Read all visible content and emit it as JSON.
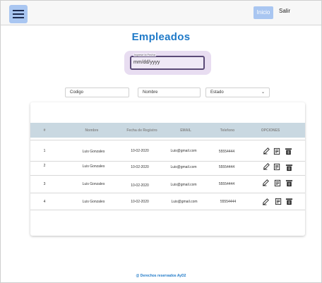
{
  "header": {
    "inicio": "Inicio",
    "salir": "Salir"
  },
  "main": {
    "title": "Empleados",
    "date": {
      "label": "Ingrese la Fecha",
      "placeholder": "mm/dd/yyyy"
    },
    "filters": {
      "codigo": "Codigo",
      "nombre": "Nombre",
      "estado": "Estado"
    }
  },
  "table": {
    "headers": [
      "#",
      "Nombre",
      "Fecha de Registro",
      "EMAIL",
      "Telefono",
      "OPCIONES"
    ],
    "rows": [
      {
        "num": "1",
        "nombre": "Luis Gonzales",
        "fecha": "10-02-2020",
        "email": "Luis@gmail.com",
        "telefono": "55554444"
      },
      {
        "num": "2",
        "nombre": "Luis Gonzales",
        "fecha": "10-02-2020",
        "email": "Luis@gmail.com",
        "telefono": "55554444"
      },
      {
        "num": "3",
        "nombre": "Luis Gonzales",
        "fecha": "10-02-2020",
        "email": "Luis@gmail.com",
        "telefono": "55554444"
      },
      {
        "num": "4",
        "nombre": "Luis Gonzales",
        "fecha": "10-02-2020",
        "email": "Luis@gmail.com",
        "telefono": "55554444"
      }
    ]
  },
  "footer": "@ Derechos reservados AyD2",
  "colors": {
    "accent": "#1f7ac8",
    "nav_button": "#a9c6f1",
    "table_header": "#c9d8e1"
  },
  "icons": [
    "menu-icon",
    "edit-icon",
    "details-icon",
    "delete-icon",
    "chevron-down-icon"
  ]
}
